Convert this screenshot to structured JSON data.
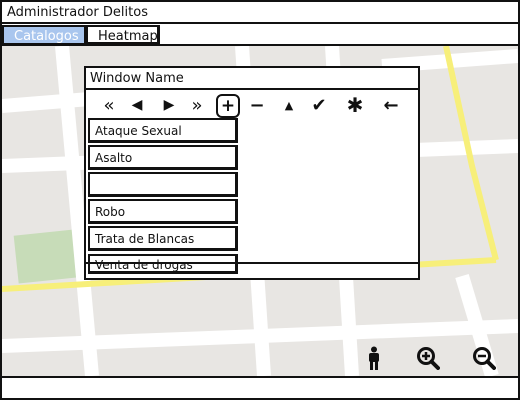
{
  "app": {
    "title": "Administrador Delitos"
  },
  "tabs": [
    {
      "label": "Catalogos",
      "active": true
    },
    {
      "label": "Heatmap",
      "active": false
    }
  ],
  "window": {
    "title": "Window Name",
    "toolbar": {
      "first": "«",
      "prev": "◀",
      "next": "▶",
      "last": "»",
      "add": "+",
      "remove": "−",
      "up": "▲",
      "check": "✔",
      "asterisk": "✱",
      "back": "←"
    },
    "items": [
      "Ataque Sexual",
      "Asalto",
      "",
      "Robo",
      "Trata de Blancas",
      "Venta de drogas"
    ]
  },
  "map": {
    "colors": {
      "land": "#e8e6e3",
      "road": "#ffffff",
      "highway": "#f7ef7a",
      "park": "#c7dcb8"
    },
    "controls": [
      "person-icon",
      "zoom-in-icon",
      "zoom-out-icon"
    ]
  }
}
